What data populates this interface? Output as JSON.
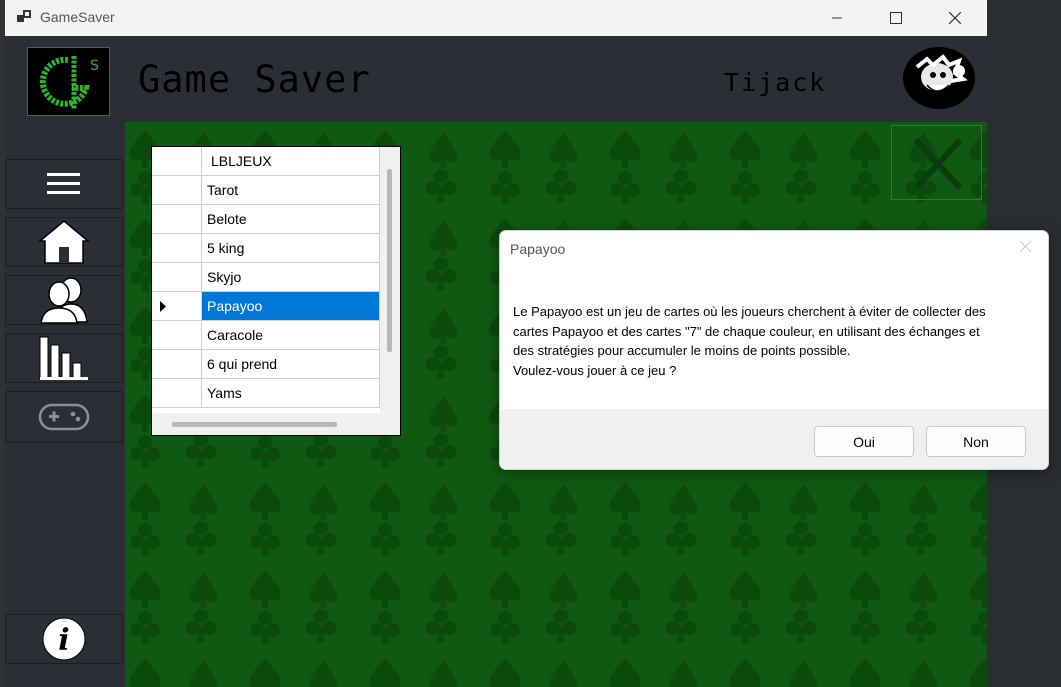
{
  "window": {
    "title": "GameSaver",
    "controls": [
      "minimize-icon",
      "maximize-icon",
      "close-icon"
    ]
  },
  "header": {
    "logo_text": "GS",
    "app_title": "Game Saver",
    "username": "Tijack"
  },
  "sidebar": {
    "items": [
      {
        "name": "menu",
        "icon": "hamburger-icon"
      },
      {
        "name": "home",
        "icon": "home-icon"
      },
      {
        "name": "users",
        "icon": "users-icon"
      },
      {
        "name": "stats",
        "icon": "bar-chart-icon"
      },
      {
        "name": "games",
        "icon": "gamepad-icon"
      },
      {
        "name": "info",
        "icon": "info-icon"
      }
    ]
  },
  "games_grid": {
    "header": "LBLJEUX",
    "rows": [
      "Tarot",
      "Belote",
      "5 king",
      "Skyjo",
      "Papayoo",
      "Caracole",
      "6 qui prend",
      "Yams"
    ],
    "selected": "Papayoo"
  },
  "dialog": {
    "title": "Papayoo",
    "message": "Le Papayoo est un jeu de cartes où les joueurs cherchent à éviter de collecter des\ncartes Papayoo et des cartes \"7\" de chaque couleur, en utilisant des échanges et\ndes stratégies pour accumuler le moins de points possible.\nVoulez-vous jouer à ce jeu ?",
    "yes_label": "Oui",
    "no_label": "Non"
  },
  "colors": {
    "felt": "#0f5a12",
    "pattern": "#0b4a0d",
    "selection": "#0078d7",
    "logo_green": "#2fb02f"
  }
}
